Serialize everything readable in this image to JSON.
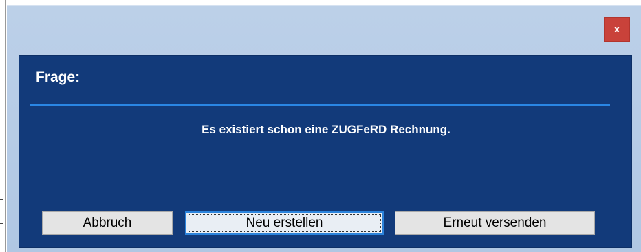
{
  "window": {
    "close_label": "x"
  },
  "dialog": {
    "title": "Frage:",
    "message": "Es existiert schon eine ZUGFeRD Rechnung."
  },
  "buttons": {
    "cancel": "Abbruch",
    "create_new": "Neu erstellen",
    "resend": "Erneut versenden"
  },
  "colors": {
    "panel_bg": "#123a7a",
    "divider": "#2a86e4",
    "close_bg": "#c9423a",
    "button_bg": "#e4e4e4",
    "focus_border": "#2c84dc"
  }
}
